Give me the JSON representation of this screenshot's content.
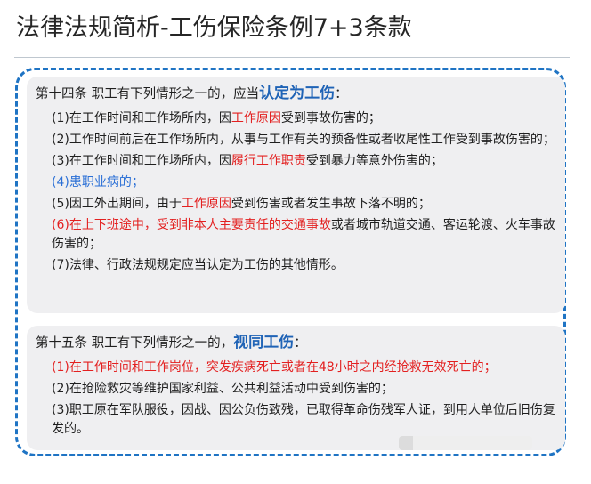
{
  "title": "法律法规简析-工伤保险条例7+3条款",
  "article14": {
    "heading_prefix": "第十四条  职工有下列情形之一的，应当",
    "heading_emphasis": "认定为工伤",
    "heading_suffix": "：",
    "items": [
      [
        "(1)在工作时间和工作场所内，因",
        "工作原因",
        "受到事故伤害的；"
      ],
      [
        "(2)工作时间前后在工作场所内，从事与工作有关的预备性或者收尾性工作受到事故伤害的；"
      ],
      [
        "(3)在工作时间和工作场所内，因",
        "履行工作职责",
        "受到暴力等意外伤害的；"
      ],
      [
        "(4)患职业病的；"
      ],
      [
        "(5)因工外出期间，由于",
        "工作原因",
        "受到伤害或者发生事故下落不明的；"
      ],
      [
        "(6)",
        "在上下班途中，受到非本人主要责任的交通事故",
        "或者城市轨道交通、客运轮渡、火车事故伤害的；"
      ],
      [
        "(7)法律、行政法规规定应当认定为工伤的其他情形。"
      ]
    ]
  },
  "article15": {
    "heading_prefix": "第十五条  职工有下列情形之一的，",
    "heading_emphasis": "视同工伤",
    "heading_suffix": "：",
    "items": [
      [
        "(1)在工作时间和工作岗位，突发疾病死亡或者在48小时之内经抢救无效死亡的；"
      ],
      [
        "(2)在抢险救灾等维护国家利益、公共利益活动中受到伤害的；"
      ],
      [
        "(3)职工原在军队服役，因战、因公负伤致残，已取得革命伤残军人证，到用人单位后旧伤复发的。"
      ]
    ]
  },
  "colors": {
    "accent": "#1f74c4",
    "emphasis": "#1f63b6",
    "red": "#e32020",
    "blue_item": "#2a6fd6",
    "panel": "#efeff1"
  }
}
